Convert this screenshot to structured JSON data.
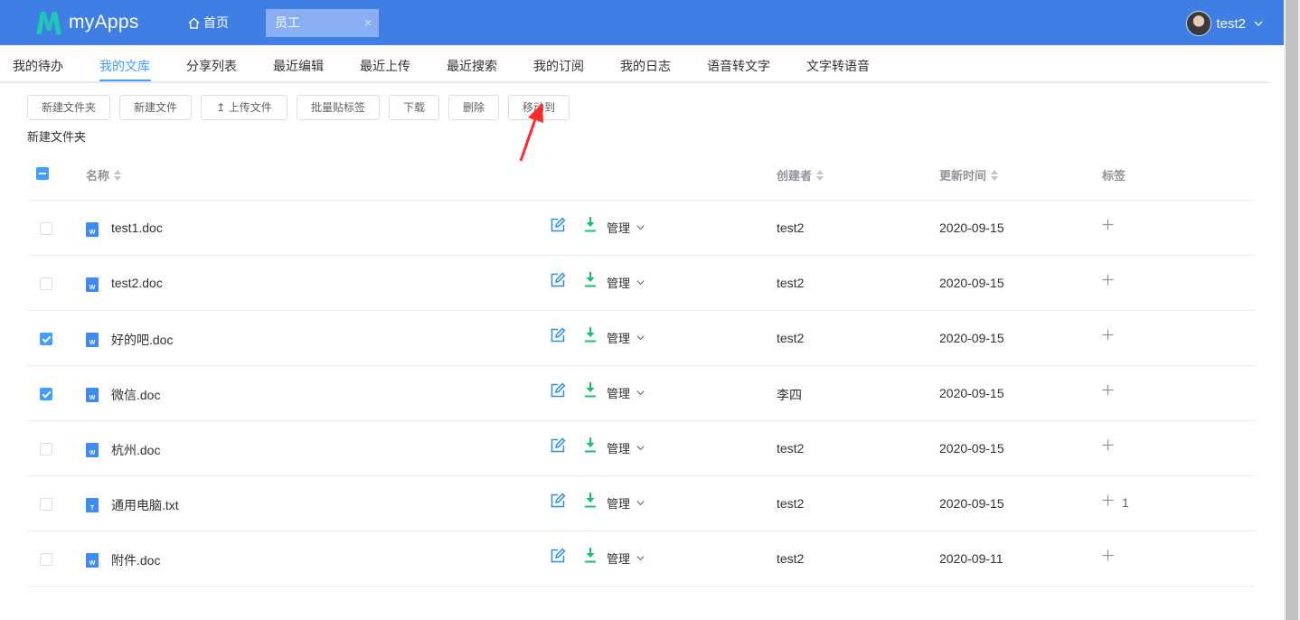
{
  "app": {
    "name": "myApps",
    "home_label": "首页",
    "active_tab": "员工",
    "tab_close": "×",
    "user_name": "test2"
  },
  "colors": {
    "header": "#3f7fe5",
    "accent": "#409eff",
    "logo": "#21c7b6",
    "download": "#13c26b",
    "arrow": "#ff2a2a"
  },
  "subnav": {
    "items": [
      "我的待办",
      "我的文库",
      "分享列表",
      "最近编辑",
      "最近上传",
      "最近搜索",
      "我的订阅",
      "我的日志",
      "语音转文字",
      "文字转语音"
    ],
    "active": "我的文库"
  },
  "toolbar": {
    "new_folder": "新建文件夹",
    "new_file": "新建文件",
    "upload": "上传文件",
    "batch_tag": "批量贴标签",
    "download": "下载",
    "delete": "删除",
    "move_to": "移动到"
  },
  "folder_hint": "新建文件夹",
  "table": {
    "headers": {
      "name": "名称",
      "creator": "创建者",
      "updated": "更新时间",
      "tags": "标签"
    },
    "manage_label": "管理",
    "rows": [
      {
        "name": "test1.doc",
        "type": "W",
        "creator": "test2",
        "date": "2020-09-15",
        "checked": false,
        "tag_count": ""
      },
      {
        "name": "test2.doc",
        "type": "W",
        "creator": "test2",
        "date": "2020-09-15",
        "checked": false,
        "tag_count": ""
      },
      {
        "name": "好的吧.doc",
        "type": "W",
        "creator": "test2",
        "date": "2020-09-15",
        "checked": true,
        "tag_count": ""
      },
      {
        "name": "微信.doc",
        "type": "W",
        "creator": "李四",
        "date": "2020-09-15",
        "checked": true,
        "tag_count": ""
      },
      {
        "name": "杭州.doc",
        "type": "W",
        "creator": "test2",
        "date": "2020-09-15",
        "checked": false,
        "tag_count": ""
      },
      {
        "name": "通用电脑.txt",
        "type": "T",
        "creator": "test2",
        "date": "2020-09-15",
        "checked": false,
        "tag_count": "1"
      },
      {
        "name": "附件.doc",
        "type": "W",
        "creator": "test2",
        "date": "2020-09-11",
        "checked": false,
        "tag_count": ""
      }
    ]
  }
}
